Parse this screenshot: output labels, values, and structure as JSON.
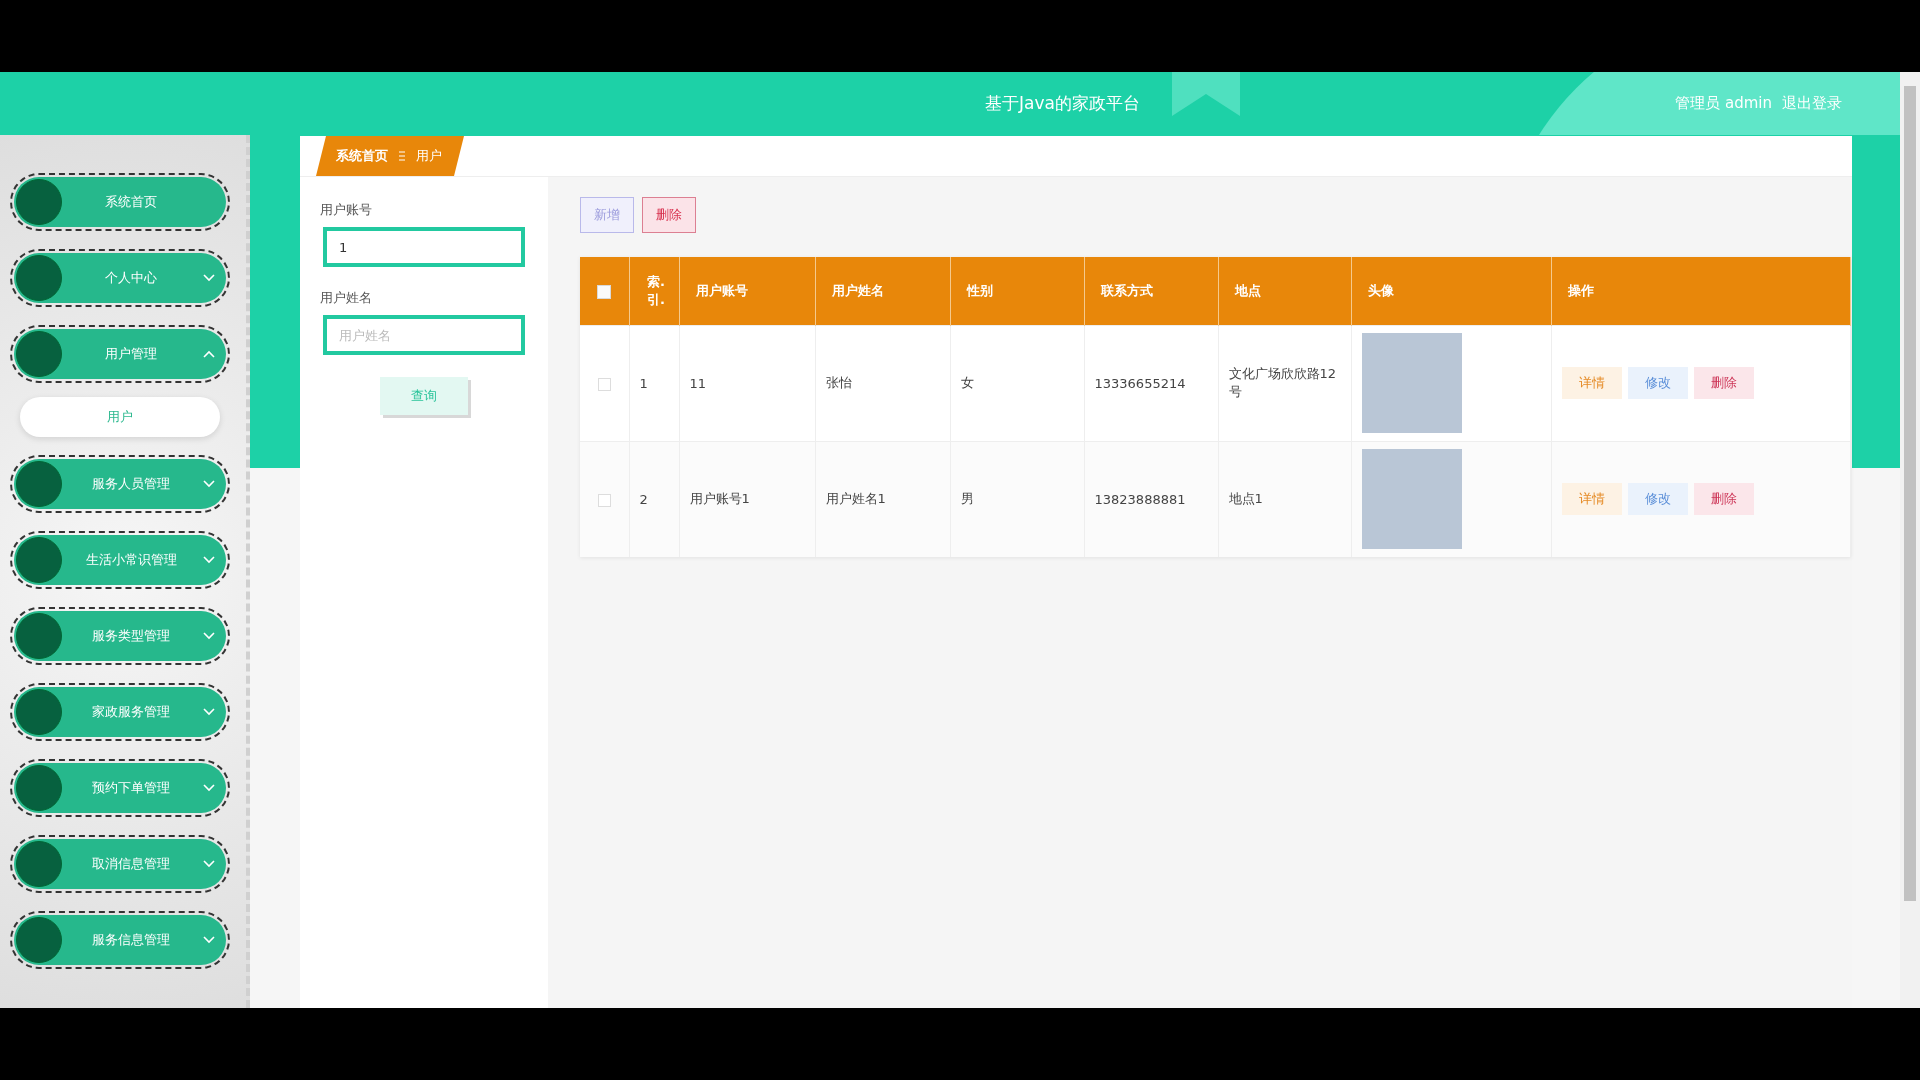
{
  "header": {
    "title": "基于Java的家政平台",
    "user_label": "管理员 admin",
    "logout": "退出登录"
  },
  "sidebar": {
    "items": [
      {
        "label": "系统首页",
        "kind": "link"
      },
      {
        "label": "个人中心",
        "kind": "group",
        "expanded": false
      },
      {
        "label": "用户管理",
        "kind": "group",
        "expanded": true,
        "children": [
          {
            "label": "用户",
            "selected": true
          }
        ]
      },
      {
        "label": "服务人员管理",
        "kind": "group",
        "expanded": false
      },
      {
        "label": "生活小常识管理",
        "kind": "group",
        "expanded": false
      },
      {
        "label": "服务类型管理",
        "kind": "group",
        "expanded": false
      },
      {
        "label": "家政服务管理",
        "kind": "group",
        "expanded": false
      },
      {
        "label": "预约下单管理",
        "kind": "group",
        "expanded": false
      },
      {
        "label": "取消信息管理",
        "kind": "group",
        "expanded": false
      },
      {
        "label": "服务信息管理",
        "kind": "group",
        "expanded": false
      }
    ]
  },
  "breadcrumb": [
    "系统首页",
    "用户"
  ],
  "search": {
    "fields": [
      {
        "label": "用户账号",
        "value": "1"
      },
      {
        "label": "用户姓名",
        "placeholder": "用户姓名"
      }
    ],
    "button": "查询"
  },
  "toolbar": [
    {
      "label": "新增",
      "kind": "add"
    },
    {
      "label": "删除",
      "kind": "delete"
    }
  ],
  "table": {
    "select_all": {
      "checked": false
    },
    "columns": [
      "索. 引.",
      "用户账号",
      "用户姓名",
      "性别",
      "联系方式",
      "地点",
      "头像",
      "操作"
    ],
    "rows": [
      {
        "checked": false,
        "cells": [
          "1",
          "11",
          "张怡",
          "女",
          "13336655214",
          "文化广场欣欣路12号"
        ],
        "actions": [
          {
            "label": "详情",
            "kind": "detail"
          },
          {
            "label": "修改",
            "kind": "edit"
          },
          {
            "label": "删除",
            "kind": "delete"
          }
        ]
      },
      {
        "checked": false,
        "cells": [
          "2",
          "用户账号1",
          "用户姓名1",
          "男",
          "13823888881",
          "地点1"
        ],
        "actions": [
          {
            "label": "详情",
            "kind": "detail"
          },
          {
            "label": "修改",
            "kind": "edit"
          },
          {
            "label": "删除",
            "kind": "delete"
          }
        ]
      }
    ]
  }
}
